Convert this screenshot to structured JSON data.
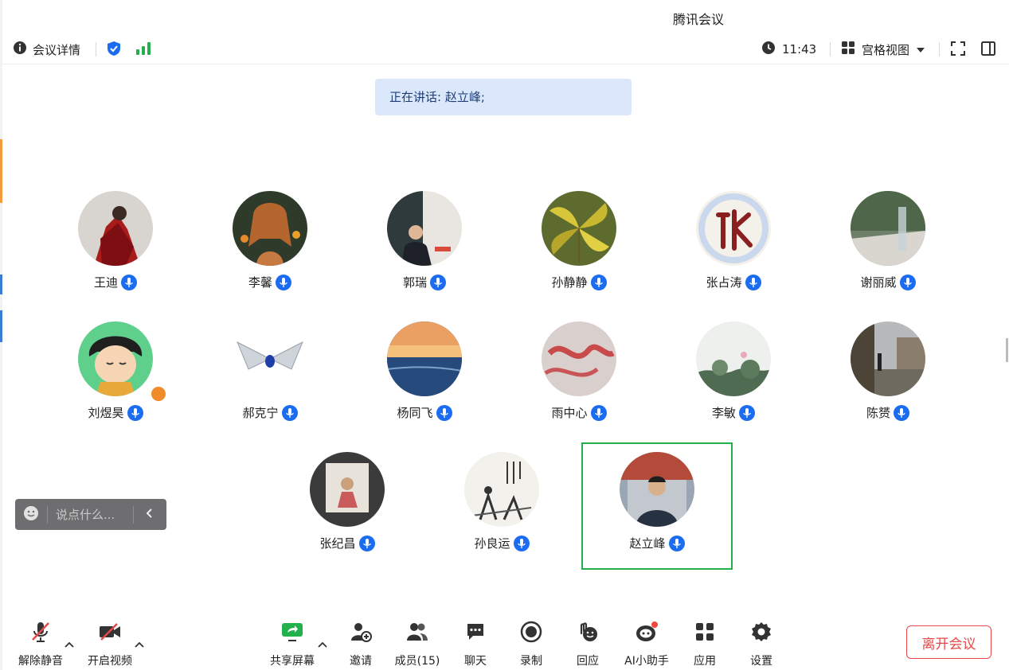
{
  "app": {
    "title": "腾讯会议"
  },
  "topbar": {
    "details_label": "会议详情",
    "time": "11:43",
    "view_mode": "宫格视图"
  },
  "speaking": {
    "text": "正在讲话: 赵立峰;"
  },
  "participants": [
    {
      "name": "王迪"
    },
    {
      "name": "李馨"
    },
    {
      "name": "郭瑞"
    },
    {
      "name": "孙静静"
    },
    {
      "name": "张占涛"
    },
    {
      "name": "谢丽威"
    },
    {
      "name": "刘煜昊"
    },
    {
      "name": "郝克宁"
    },
    {
      "name": "杨同飞"
    },
    {
      "name": "雨中心"
    },
    {
      "name": "李敏"
    },
    {
      "name": "陈赟"
    },
    {
      "name": "张纪昌"
    },
    {
      "name": "孙良运"
    },
    {
      "name": "赵立峰"
    }
  ],
  "chat": {
    "placeholder": "说点什么..."
  },
  "toolbar": {
    "unmute": "解除静音",
    "start_video": "开启视频",
    "share_screen": "共享屏幕",
    "invite": "邀请",
    "members": "成员(15)",
    "chat": "聊天",
    "record": "录制",
    "reactions": "回应",
    "ai_assistant": "AI小助手",
    "apps": "应用",
    "settings": "设置",
    "leave": "离开会议"
  },
  "colors": {
    "accent": "#1c6cf2",
    "active_speaker": "#22b14c",
    "leave": "#e64949",
    "speaking_bg": "#dbe8fb"
  }
}
